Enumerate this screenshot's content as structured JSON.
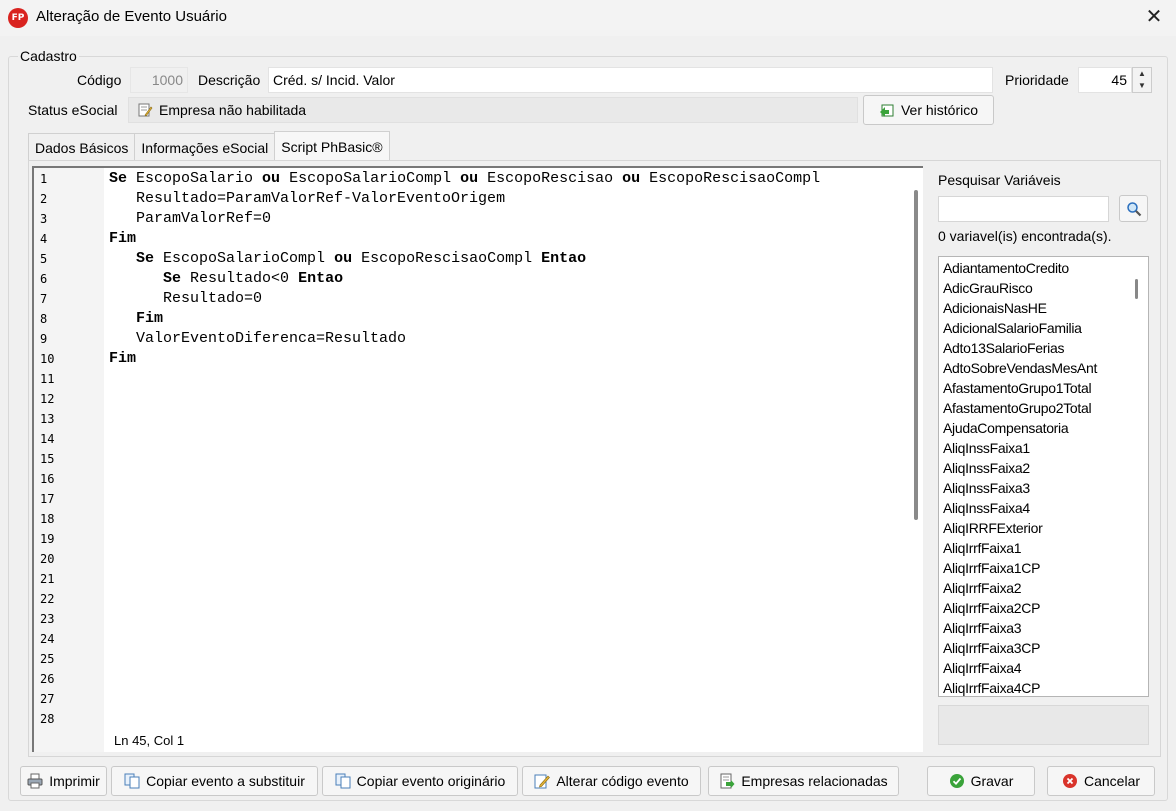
{
  "window": {
    "logo_text": "FP",
    "title": "Alteração de Evento Usuário",
    "close_glyph": "✕"
  },
  "cadastro": {
    "legend": "Cadastro",
    "codigo_label": "Código",
    "codigo_value": "1000",
    "descricao_label": "Descrição",
    "descricao_value": "Créd. s/ Incid. Valor",
    "prioridade_label": "Prioridade",
    "prioridade_value": "45",
    "status_label": "Status eSocial",
    "status_value": "Empresa não habilitada",
    "historico_button": "Ver histórico"
  },
  "tabs": [
    {
      "label": "Dados Básicos",
      "active": false
    },
    {
      "label": "Informações eSocial",
      "active": false
    },
    {
      "label": "Script PhBasic®",
      "active": true
    }
  ],
  "editor": {
    "line_numbers": [
      "1",
      "2",
      "3",
      "4",
      "5",
      "6",
      "7",
      "8",
      "9",
      "10",
      "11",
      "12",
      "13",
      "14",
      "15",
      "16",
      "17",
      "18",
      "19",
      "20",
      "21",
      "22",
      "23",
      "24",
      "25",
      "26",
      "27",
      "28"
    ],
    "lines": [
      [
        {
          "t": "Se",
          "k": true
        },
        {
          "t": " EscopoSalario "
        },
        {
          "t": "ou",
          "k": true
        },
        {
          "t": " EscopoSalarioCompl "
        },
        {
          "t": "ou",
          "k": true
        },
        {
          "t": " EscopoRescisao "
        },
        {
          "t": "ou",
          "k": true
        },
        {
          "t": " EscopoRescisaoCompl"
        }
      ],
      [
        {
          "t": "   Resultado=ParamValorRef-ValorEventoOrigem"
        }
      ],
      [
        {
          "t": "   ParamValorRef=0"
        }
      ],
      [
        {
          "t": "Fim",
          "k": true
        }
      ],
      [
        {
          "t": "   "
        },
        {
          "t": "Se",
          "k": true
        },
        {
          "t": " EscopoSalarioCompl "
        },
        {
          "t": "ou",
          "k": true
        },
        {
          "t": " EscopoRescisaoCompl "
        },
        {
          "t": "Entao",
          "k": true
        }
      ],
      [
        {
          "t": "      "
        },
        {
          "t": "Se",
          "k": true
        },
        {
          "t": " Resultado<0 "
        },
        {
          "t": "Entao",
          "k": true
        }
      ],
      [
        {
          "t": "      Resultado=0"
        }
      ],
      [
        {
          "t": "   "
        },
        {
          "t": "Fim",
          "k": true
        }
      ],
      [
        {
          "t": "   ValorEventoDiferenca=Resultado"
        }
      ],
      [
        {
          "t": "Fim",
          "k": true
        }
      ]
    ],
    "status": "Ln 45, Col 1"
  },
  "variables": {
    "label": "Pesquisar Variáveis",
    "search_value": "",
    "count_text": "0 variavel(is) encontrada(s).",
    "items": [
      "AdiantamentoCredito",
      "AdicGrauRisco",
      "AdicionaisNasHE",
      "AdicionalSalarioFamilia",
      "Adto13SalarioFerias",
      "AdtoSobreVendasMesAnt",
      "AfastamentoGrupo1Total",
      "AfastamentoGrupo2Total",
      "AjudaCompensatoria",
      "AliqInssFaixa1",
      "AliqInssFaixa2",
      "AliqInssFaixa3",
      "AliqInssFaixa4",
      "AliqIRRFExterior",
      "AliqIrrfFaixa1",
      "AliqIrrfFaixa1CP",
      "AliqIrrfFaixa2",
      "AliqIrrfFaixa2CP",
      "AliqIrrfFaixa3",
      "AliqIrrfFaixa3CP",
      "AliqIrrfFaixa4",
      "AliqIrrfFaixa4CP"
    ]
  },
  "buttons": {
    "imprimir": "Imprimir",
    "copiar_substituir": "Copiar evento a substituir",
    "copiar_originario": "Copiar evento originário",
    "alterar_codigo": "Alterar código evento",
    "empresas": "Empresas relacionadas",
    "gravar": "Gravar",
    "cancelar": "Cancelar"
  },
  "colors": {
    "logo": "#d9231f",
    "gravar_icon": "#3aa33a",
    "cancelar_icon": "#d9342b"
  }
}
